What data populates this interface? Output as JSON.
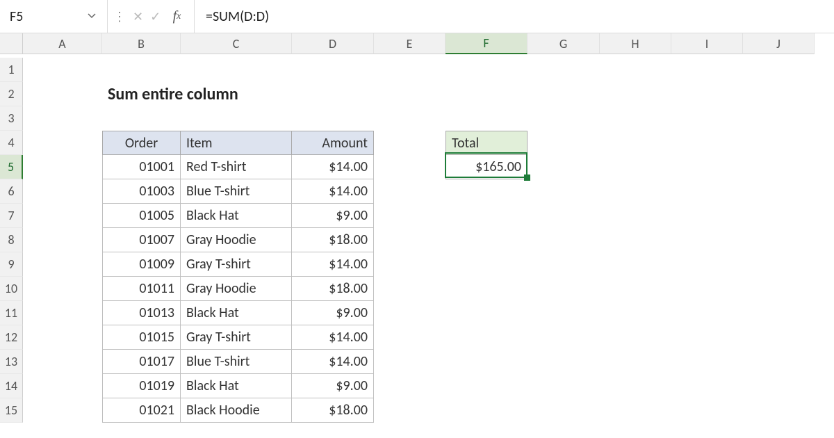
{
  "formula_bar": {
    "cell_ref": "F5",
    "formula": "=SUM(D:D)"
  },
  "columns": [
    "A",
    "B",
    "C",
    "D",
    "E",
    "F",
    "G",
    "H",
    "I",
    "J"
  ],
  "row_numbers": [
    1,
    2,
    3,
    4,
    5,
    6,
    7,
    8,
    9,
    10,
    11,
    12,
    13,
    14,
    15
  ],
  "title": "Sum entire column",
  "table": {
    "headers": {
      "order": "Order",
      "item": "Item",
      "amount": "Amount"
    },
    "rows": [
      {
        "order": "01001",
        "item": "Red T-shirt",
        "amount": "$14.00"
      },
      {
        "order": "01003",
        "item": "Blue T-shirt",
        "amount": "$14.00"
      },
      {
        "order": "01005",
        "item": "Black Hat",
        "amount": "$9.00"
      },
      {
        "order": "01007",
        "item": "Gray Hoodie",
        "amount": "$18.00"
      },
      {
        "order": "01009",
        "item": "Gray T-shirt",
        "amount": "$14.00"
      },
      {
        "order": "01011",
        "item": "Gray Hoodie",
        "amount": "$18.00"
      },
      {
        "order": "01013",
        "item": "Black Hat",
        "amount": "$9.00"
      },
      {
        "order": "01015",
        "item": "Gray T-shirt",
        "amount": "$14.00"
      },
      {
        "order": "01017",
        "item": "Blue T-shirt",
        "amount": "$14.00"
      },
      {
        "order": "01019",
        "item": "Black Hat",
        "amount": "$9.00"
      },
      {
        "order": "01021",
        "item": "Black Hoodie",
        "amount": "$18.00"
      }
    ]
  },
  "total": {
    "label": "Total",
    "value": "$165.00"
  },
  "active_cell": "F5",
  "selected_col_idx": 5,
  "selected_row_idx": 4
}
